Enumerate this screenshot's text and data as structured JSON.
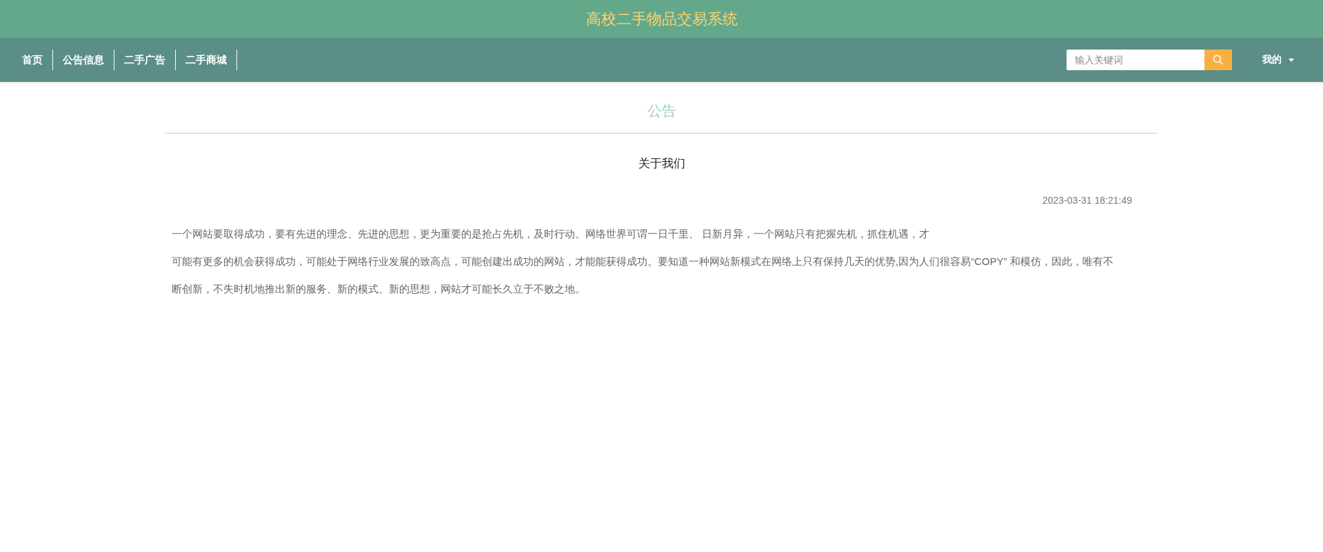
{
  "site_title": "高校二手物品交易系统",
  "nav": [
    {
      "label": "首页"
    },
    {
      "label": "公告信息"
    },
    {
      "label": "二手广告"
    },
    {
      "label": "二手商城"
    }
  ],
  "search": {
    "placeholder": "输入关键词"
  },
  "user_menu": {
    "label": "我的"
  },
  "section_title": "公告",
  "article": {
    "title": "关于我们",
    "date": "2023-03-31 18:21:49",
    "paragraphs": [
      "一个网站要取得成功，要有先进的理念、先进的思想，更为重要的是抢占先机，及时行动。网络世界可谓一日千里、 日新月异，一个网站只有把握先机，抓住机遇，才",
      "可能有更多的机会获得成功，可能处于网络行业发展的致高点，可能创建出成功的网站，才能能获得成功。要知道一种网站新模式在网络上只有保持几天的优势,因为人们很容易“COPY” 和模仿，因此，唯有不",
      "断创新，不失时机地推出新的服务、新的模式、新的思想，网站才可能长久立于不败之地。"
    ]
  }
}
